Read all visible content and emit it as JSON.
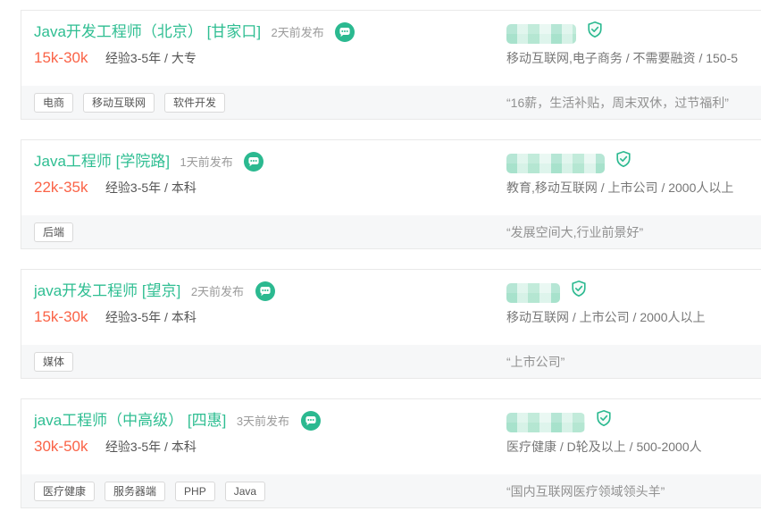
{
  "accent": {
    "green": "#2fbe92",
    "salary_color": "#fa6347",
    "footer_bg": "#f6f7f8"
  },
  "icons": {
    "chat": "chat-bubble-icon (green circle, white speech bubble with three dots)",
    "verified": "shield-check-icon (green outlined shield with checkmark)"
  },
  "jobs": [
    {
      "title": "Java开发工程师（北京） [甘家口]",
      "published": "2天前发布",
      "salary": "15k-30k",
      "requirement": "经验3-5年 / 大专",
      "tags": [
        "电商",
        "移动互联网",
        "软件开发"
      ],
      "company_info": "移动互联网,电子商务 / 不需要融资 / 150-5",
      "quote": "“16薪，生活补贴，周末双休，过节福利”"
    },
    {
      "title": "Java工程师 [学院路]",
      "published": "1天前发布",
      "salary": "22k-35k",
      "requirement": "经验3-5年 / 本科",
      "tags": [
        "后端"
      ],
      "company_info": "教育,移动互联网 / 上市公司 / 2000人以上",
      "quote": "“发展空间大,行业前景好”"
    },
    {
      "title": "java开发工程师 [望京]",
      "published": "2天前发布",
      "salary": "15k-30k",
      "requirement": "经验3-5年 / 本科",
      "tags": [
        "媒体"
      ],
      "company_info": "移动互联网 / 上市公司 / 2000人以上",
      "quote": "“上市公司”"
    },
    {
      "title": "java工程师（中高级） [四惠]",
      "published": "3天前发布",
      "salary": "30k-50k",
      "requirement": "经验3-5年 / 本科",
      "tags": [
        "医疗健康",
        "服务器端",
        "PHP",
        "Java"
      ],
      "company_info": "医疗健康 / D轮及以上 / 500-2000人",
      "quote": "“国内互联网医疗领域领头羊”"
    }
  ]
}
